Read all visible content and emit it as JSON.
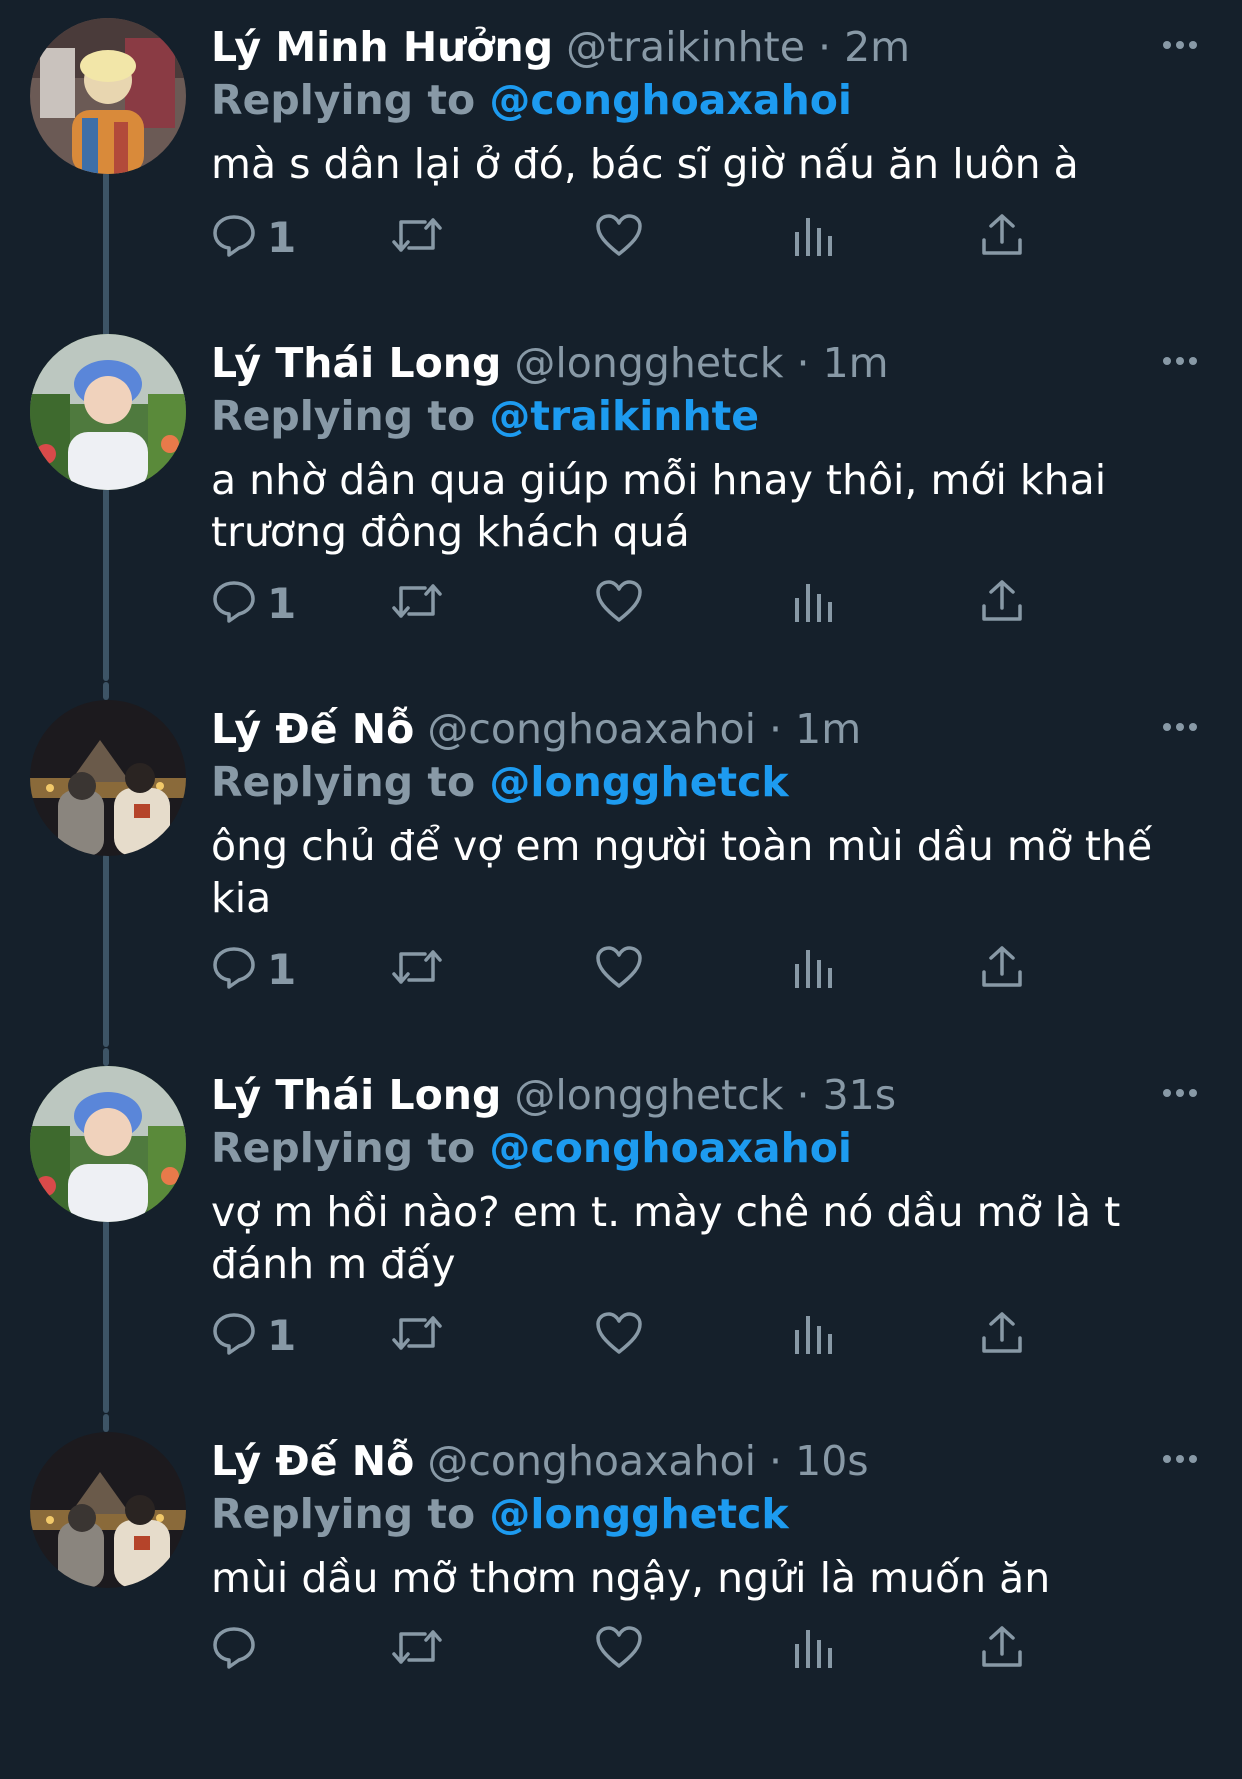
{
  "reply_prefix": "Replying to",
  "tweets": [
    {
      "name": "Lý Minh Hưởng",
      "handle": "@traikinhte",
      "time": "2m",
      "replying_to": "@conghoaxahoi",
      "text": "mà s dân lại ở đó, bác sĩ giờ nấu ăn luôn à",
      "reply_count": "1",
      "avatar": "avatar-photo-blonde"
    },
    {
      "name": "Lý Thái Long",
      "handle": "@longghetck",
      "time": "1m",
      "replying_to": "@traikinhte",
      "text": "a nhờ dân qua giúp mỗi hnay thôi, mới khai trương đông khách quá",
      "reply_count": "1",
      "avatar": "avatar-photo-blue-hair"
    },
    {
      "name": "Lý Đế Nỗ",
      "handle": "@conghoaxahoi",
      "time": "1m",
      "replying_to": "@longghetck",
      "text": "ông chủ để vợ em người toàn mùi dầu mỡ thế kia",
      "reply_count": "1",
      "avatar": "avatar-photo-louvre-night"
    },
    {
      "name": "Lý Thái Long",
      "handle": "@longghetck",
      "time": "31s",
      "replying_to": "@conghoaxahoi",
      "text": "vợ m hồi nào? em t. mày chê nó dầu mỡ là t đánh m đấy",
      "reply_count": "1",
      "avatar": "avatar-photo-blue-hair"
    },
    {
      "name": "Lý Đế Nỗ",
      "handle": "@conghoaxahoi",
      "time": "10s",
      "replying_to": "@longghetck",
      "text": "mùi dầu mỡ thơm ngậy, ngửi là muốn ăn",
      "reply_count": "",
      "avatar": "avatar-photo-louvre-night"
    }
  ],
  "icons": {
    "reply": "reply-icon",
    "retweet": "retweet-icon",
    "like": "heart-icon",
    "analytics": "analytics-icon",
    "share": "share-icon",
    "more": "more-icon"
  },
  "colors": {
    "background": "#15202b",
    "secondary_text": "#8899a6",
    "mention": "#1d9bf0",
    "thread_line": "#3d5466"
  }
}
